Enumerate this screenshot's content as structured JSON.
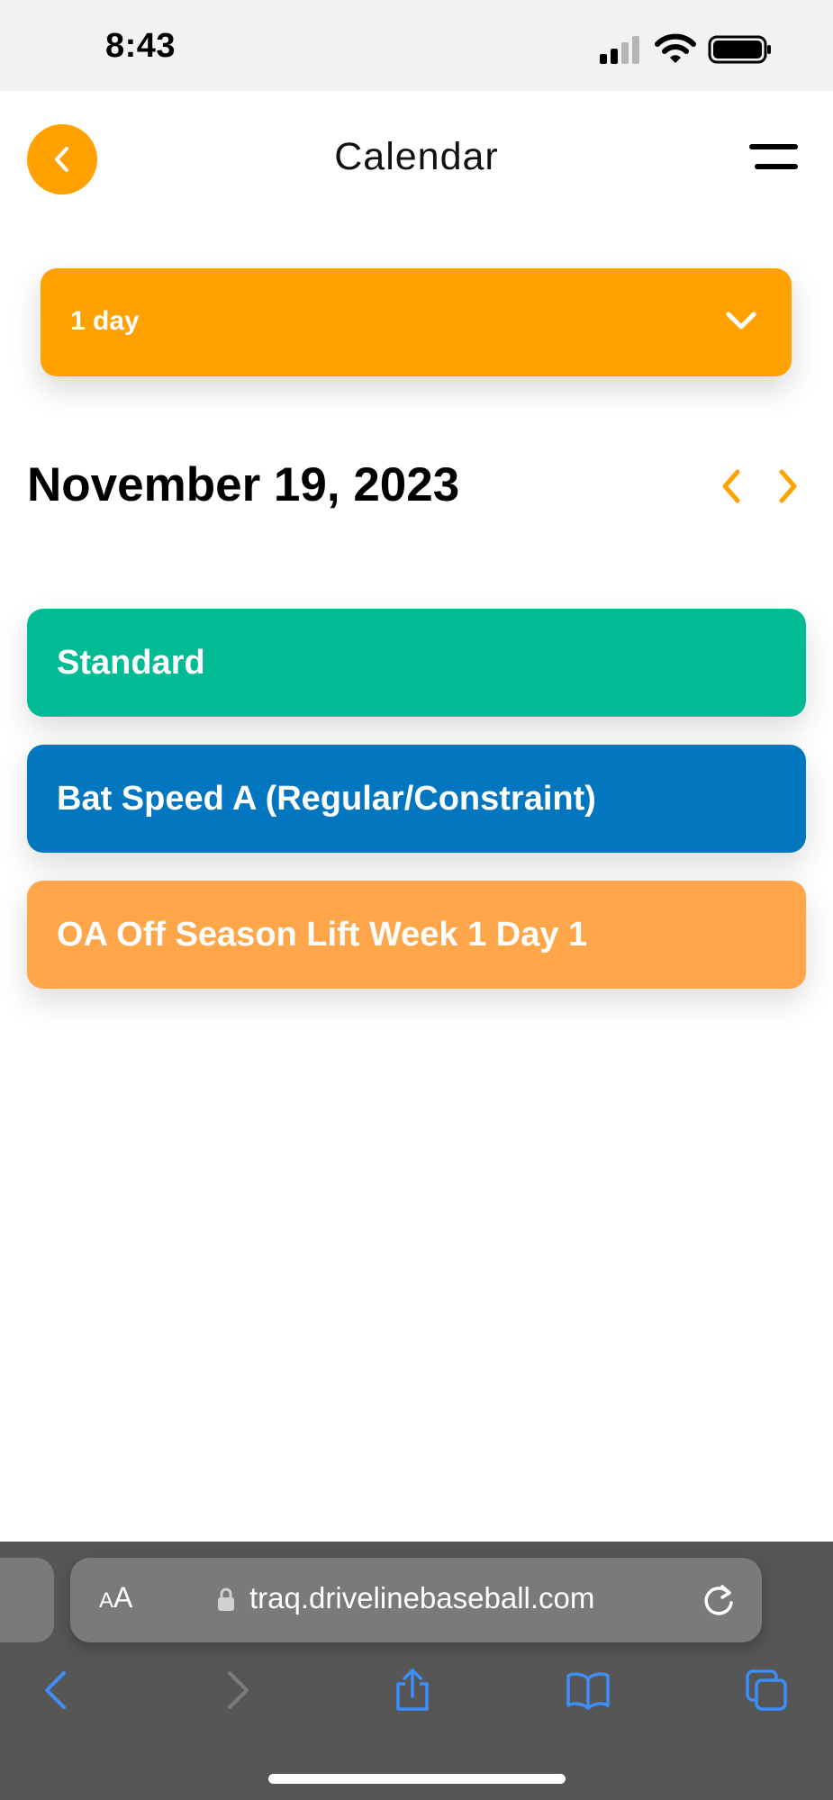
{
  "status_bar": {
    "time": "8:43"
  },
  "header": {
    "title": "Calendar",
    "back_icon": "chevron-left-icon",
    "menu_icon": "hamburger-menu-icon"
  },
  "range_select": {
    "value": "1 day",
    "icon": "chevron-down-icon"
  },
  "date": {
    "label": "November 19, 2023"
  },
  "events": [
    {
      "label": "Standard",
      "color": "#00bb94"
    },
    {
      "label": "Bat Speed A (Regular/Constraint)",
      "color": "#0276be"
    },
    {
      "label": "OA Off Season Lift Week 1 Day 1",
      "color": "#ffa54a"
    }
  ],
  "browser": {
    "text_size_small": "A",
    "text_size_large": "A",
    "url": "traq.drivelinebaseball.com",
    "toolbar_icons": [
      "back-icon",
      "forward-icon",
      "share-icon",
      "bookmarks-icon",
      "tabs-icon"
    ]
  },
  "colors": {
    "accent": "#ffa100",
    "browser_chrome": "#565656",
    "browser_link": "#3d8ef7"
  }
}
